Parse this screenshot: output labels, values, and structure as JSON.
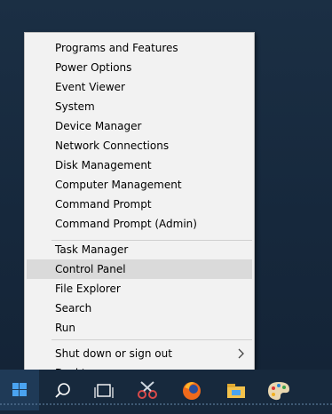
{
  "menu": {
    "group1": [
      {
        "label": "Programs and Features"
      },
      {
        "label": "Power Options"
      },
      {
        "label": "Event Viewer"
      },
      {
        "label": "System"
      },
      {
        "label": "Device Manager"
      },
      {
        "label": "Network Connections"
      },
      {
        "label": "Disk Management"
      },
      {
        "label": "Computer Management"
      },
      {
        "label": "Command Prompt"
      },
      {
        "label": "Command Prompt (Admin)"
      }
    ],
    "group2": [
      {
        "label": "Task Manager"
      },
      {
        "label": "Control Panel",
        "state": "hovered"
      },
      {
        "label": "File Explorer"
      },
      {
        "label": "Search"
      },
      {
        "label": "Run"
      }
    ],
    "group3": [
      {
        "label": "Shut down or sign out",
        "submenu_icon": "chevron-right-icon"
      },
      {
        "label": "Desktop"
      }
    ]
  },
  "taskbar": {
    "icons": [
      "windows-start-icon",
      "search-icon",
      "task-view-icon",
      "snipping-tool-icon",
      "firefox-icon",
      "file-explorer-icon",
      "paint-icon"
    ]
  },
  "colors": {
    "menu_bg": "#f2f2f2",
    "hover_bg": "#dadada",
    "desktop_bg": "#1b2f44",
    "taskbar_bg": "#17293d",
    "accent": "#2b88d8"
  }
}
